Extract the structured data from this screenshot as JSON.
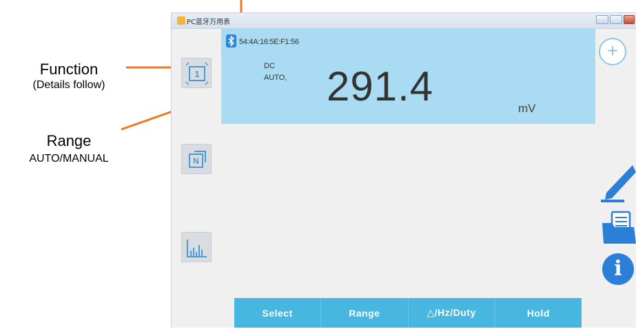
{
  "annotations": {
    "function_title": "Function",
    "function_sub": "(Details follow)",
    "range_title": "Range",
    "range_sub": "AUTO/MANUAL"
  },
  "window": {
    "title": "PC蓝牙万用表"
  },
  "display": {
    "mac_address": "54:4A:16:5E:F1:56",
    "function": "DC",
    "range_mode": "AUTO,",
    "reading": "291.4",
    "unit": "mV"
  },
  "buttons": {
    "select": "Select",
    "range": "Range",
    "hz_duty": "△/Hz/Duty",
    "hold": "Hold"
  },
  "left_tools": [
    {
      "name": "single-mode-icon",
      "label": "1"
    },
    {
      "name": "n-mode-icon",
      "label": "N"
    },
    {
      "name": "chart-icon",
      "label": ""
    }
  ],
  "right_icons": {
    "add": "+",
    "info": "i"
  },
  "colors": {
    "display_bg": "#a9dcf2",
    "button_bar": "#48b7e0",
    "callout": "#ee7722",
    "icon_blue": "#2b7fd6"
  }
}
